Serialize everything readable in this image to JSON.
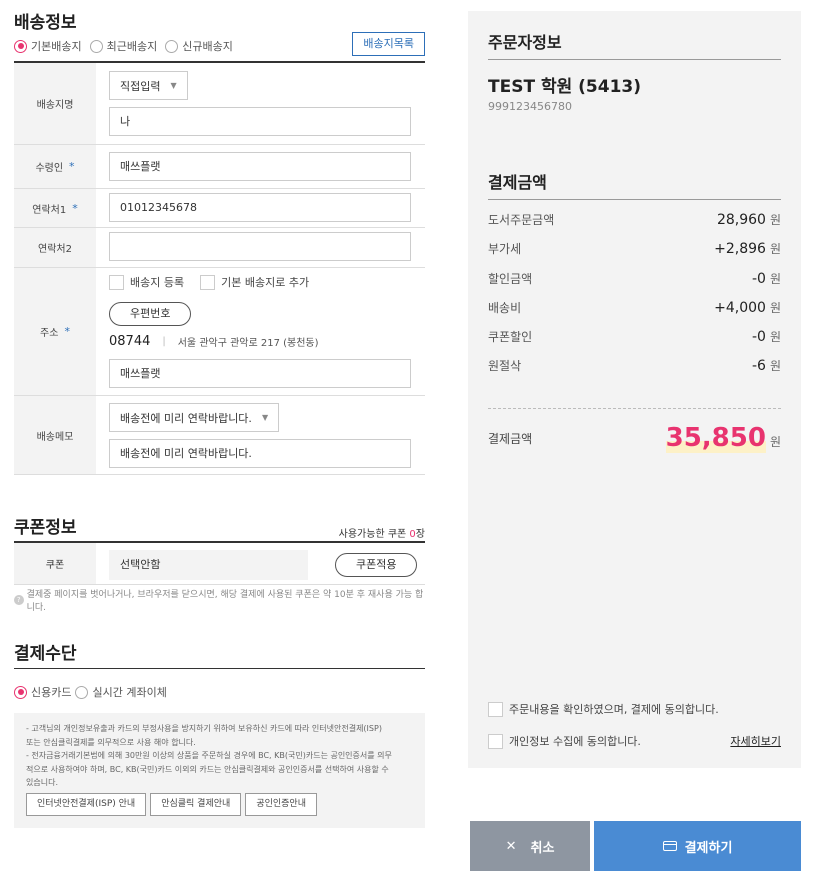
{
  "shipping": {
    "title": "배송정보",
    "options": [
      "기본배송지",
      "최근배송지",
      "신규배송지"
    ],
    "address_list_button": "배송지목록",
    "name_label": "배송지명",
    "name_select": "직접입력",
    "name_value": "나",
    "recipient_label": "수령인",
    "recipient_value": "매쓰플랫",
    "phone1_label": "연락처1",
    "phone1_value": "01012345678",
    "phone2_label": "연락처2",
    "phone2_value": "",
    "address_label": "주소",
    "register_address": "배송지 등록",
    "add_default": "기본 배송지로 추가",
    "postcode_button": "우편번호",
    "zip": "08744",
    "address": "서울 관악구 관악로 217 (봉천동)",
    "address_detail": "매쓰플랫",
    "memo_label": "배송메모",
    "memo_select": "배송전에 미리 연락바랍니다.",
    "memo_value": "배송전에 미리 연락바랍니다.",
    "required_mark": "*"
  },
  "coupon": {
    "title": "쿠폰정보",
    "available_prefix": "사용가능한 쿠폰 ",
    "available_count": "0",
    "available_suffix": "장",
    "label": "쿠폰",
    "selected": "선택안함",
    "apply_button": "쿠폰적용",
    "note": "결제중 페이지를 벗어나거나, 브라우저를 닫으시면, 해당 결제에 사용된 쿠폰은 약 10분 후 재사용 가능 합니다."
  },
  "payment": {
    "title": "결제수단",
    "options": [
      "신용카드",
      "실시간 계좌이체"
    ],
    "info": [
      "- 고객님의 개인정보유출과 카드의 부정사용을 방지하기 위하여 보유하신 카드에 따라 인터넷안전결제(ISP)",
      "또는 안심클릭결제를 의무적으로 사용 해야 합니다.",
      "- 전자금융거래기본법에 의해 30만원 이상의 상품을 주문하실 경우에 BC, KB(국민)카드는 공인인증서를 의무",
      "적으로 사용하여야 하며, BC, KB(국민)카드 이외의 카드는 안심클릭결제와 공인인증서를 선택하여 사용할 수",
      "있습니다."
    ],
    "buttons": [
      "인터넷안전결제(ISP) 안내",
      "안심클릭 결제안내",
      "공인인증안내"
    ]
  },
  "orderer": {
    "title": "주문자정보",
    "name": "TEST 학원 (5413)",
    "code": "999123456780"
  },
  "summary": {
    "title": "결제금액",
    "currency": "원",
    "rows": [
      {
        "label": "도서주문금액",
        "amount": "28,960"
      },
      {
        "label": "부가세",
        "amount": "+2,896"
      },
      {
        "label": "할인금액",
        "amount": "-0"
      },
      {
        "label": "배송비",
        "amount": "+4,000"
      },
      {
        "label": "쿠폰할인",
        "amount": "-0"
      },
      {
        "label": "원절삭",
        "amount": "-6"
      }
    ],
    "total_label": "결제금액",
    "total": "35,850"
  },
  "agreements": {
    "order_confirm": "주문내용을 확인하였으며, 결제에 동의합니다.",
    "privacy": "개인정보 수집에 동의합니다.",
    "details": "자세히보기"
  },
  "actions": {
    "cancel": "취소",
    "pay": "결제하기",
    "cancel_glyph": "✕"
  },
  "colors": {
    "accent_pink": "#e8336f",
    "accent_blue": "#4a8bd3",
    "cancel_gray": "#8e96a1",
    "panel_bg": "#f3f3f3"
  }
}
